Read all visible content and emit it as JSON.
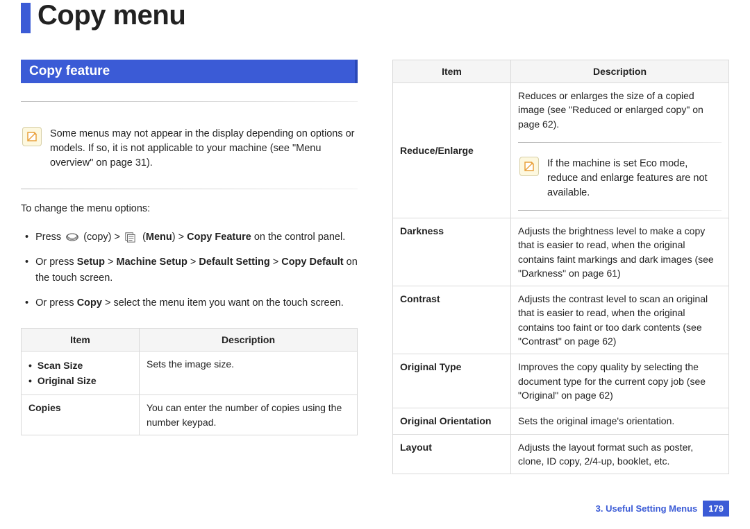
{
  "page_title": "Copy menu",
  "section_header": "Copy feature",
  "top_note": "Some menus may not appear in the display depending on options or models. If so, it is not applicable to your machine (see \"Menu overview\" on page 31).",
  "intro": "To change the menu options:",
  "bullets": {
    "b1_pre": "Press",
    "b1_copy": "(copy) >",
    "b1_menu": "(Menu)",
    "b1_post": "> Copy Feature on the control panel.",
    "b1_menu_bold": "Menu",
    "b1_cf_bold": "Copy Feature",
    "b1_full_pre": "Press ",
    "b2_pre": "Or press ",
    "b2_seq": [
      "Setup",
      "Machine Setup",
      "Default Setting",
      "Copy Default"
    ],
    "b2_post": " on the touch screen.",
    "b3_pre": "Or press ",
    "b3_bold": "Copy",
    "b3_post": " > select the menu item you want on the touch screen."
  },
  "table_headers": {
    "item": "Item",
    "desc": "Description"
  },
  "left_table": [
    {
      "item_lines": [
        "Scan Size",
        "Original Size"
      ],
      "desc": "Sets the image size."
    },
    {
      "item_lines": [
        "Copies"
      ],
      "desc": "You can enter the number of copies using the number keypad."
    }
  ],
  "right_table": [
    {
      "item": "Reduce/Enlarge",
      "desc_pre": "Reduces or enlarges the size of a copied image (see \"Reduced or enlarged copy\" on page 62).",
      "note": "If the machine is set Eco mode, reduce and enlarge features are not available."
    },
    {
      "item": "Darkness",
      "desc": "Adjusts the brightness level to make a copy that is easier to read, when the original contains faint markings and dark images (see \"Darkness\" on page 61)"
    },
    {
      "item": "Contrast",
      "desc": "Adjusts the contrast level to scan an original that is easier to read, when the original contains too faint or too dark contents (see \"Contrast\" on page 62)"
    },
    {
      "item": "Original Type",
      "desc": "Improves the copy quality by selecting the document type for the current copy job (see \"Original\" on page 62)"
    },
    {
      "item": "Original Orientation",
      "desc": "Sets the original image's orientation."
    },
    {
      "item": "Layout",
      "desc": "Adjusts the layout format such as poster, clone, ID copy, 2/4-up, booklet, etc."
    }
  ],
  "footer": {
    "chapter": "3.  Useful Setting Menus",
    "page": "179"
  }
}
